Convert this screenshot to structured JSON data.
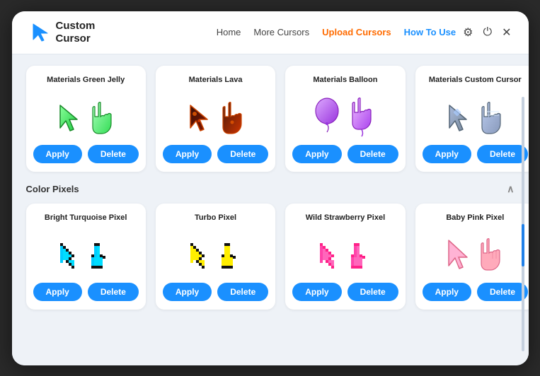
{
  "header": {
    "logo_line1": "Custom",
    "logo_line2": "Cursor",
    "nav": [
      {
        "label": "Home",
        "style": "normal"
      },
      {
        "label": "More Cursors",
        "style": "normal"
      },
      {
        "label": "Upload Cursors",
        "style": "accent"
      },
      {
        "label": "How To Use",
        "style": "blue"
      }
    ],
    "icons": [
      "gear",
      "power",
      "close"
    ]
  },
  "sections": [
    {
      "id": "materials",
      "label": "",
      "cards": [
        {
          "title": "Materials Green Jelly",
          "cursor_color1": "#4dfa6a",
          "cursor_color2": "#2ec44d",
          "apply_label": "Apply",
          "delete_label": "Delete"
        },
        {
          "title": "Materials Lava",
          "cursor_color1": "#4a1a0a",
          "cursor_color2": "#cc3300",
          "apply_label": "Apply",
          "delete_label": "Delete"
        },
        {
          "title": "Materials Balloon",
          "cursor_color1": "#cc88ff",
          "cursor_color2": "#aa44ee",
          "apply_label": "Apply",
          "delete_label": "Delete"
        },
        {
          "title": "Materials Custom Cursor",
          "cursor_color1": "#8899cc",
          "cursor_color2": "#aabbee",
          "apply_label": "Apply",
          "delete_label": "Delete"
        }
      ]
    },
    {
      "id": "color-pixels",
      "label": "Color Pixels",
      "cards": [
        {
          "title": "Bright Turquoise Pixel",
          "cursor_color1": "#00ccff",
          "cursor_color2": "#00ffdd",
          "apply_label": "Apply",
          "delete_label": "Delete"
        },
        {
          "title": "Turbo Pixel",
          "cursor_color1": "#ffee00",
          "cursor_color2": "#222222",
          "apply_label": "Apply",
          "delete_label": "Delete"
        },
        {
          "title": "Wild Strawberry Pixel",
          "cursor_color1": "#ff2288",
          "cursor_color2": "#ff44aa",
          "apply_label": "Apply",
          "delete_label": "Delete"
        },
        {
          "title": "Baby Pink Pixel",
          "cursor_color1": "#ffaacc",
          "cursor_color2": "#ff88bb",
          "apply_label": "Apply",
          "delete_label": "Delete"
        }
      ]
    }
  ]
}
